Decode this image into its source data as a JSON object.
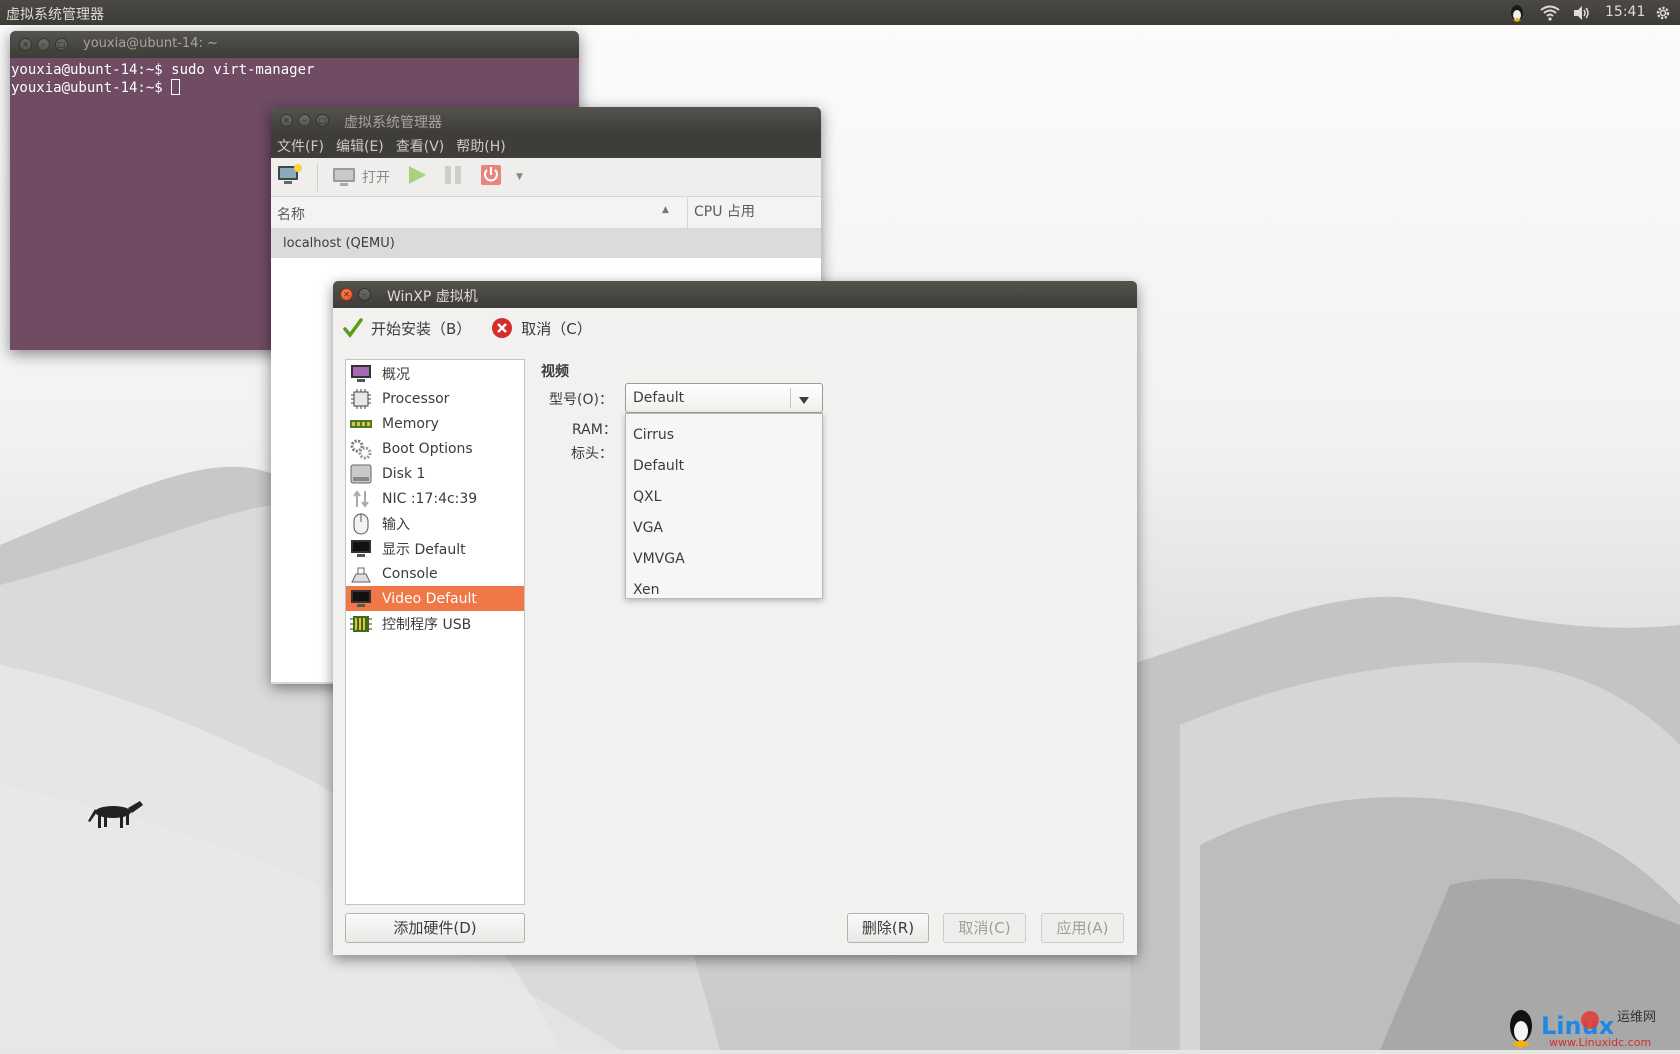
{
  "top_panel": {
    "title": "虚拟系统管理器",
    "clock": "15:41",
    "indicators": [
      "qq-penguin-icon",
      "wifi-icon",
      "volume-icon",
      "gear-icon"
    ]
  },
  "terminal": {
    "title": "youxia@ubunt-14: ~",
    "lines": [
      "youxia@ubunt-14:~$ sudo virt-manager",
      "youxia@ubunt-14:~$ "
    ]
  },
  "vmm": {
    "title": "虚拟系统管理器",
    "menus": [
      "文件(F)",
      "编辑(E)",
      "查看(V)",
      "帮助(H)"
    ],
    "toolbar": {
      "open_label": "打开"
    },
    "columns": {
      "name": "名称",
      "cpu": "CPU 占用"
    },
    "rows": [
      "localhost (QEMU)"
    ]
  },
  "dialog": {
    "title": "WinXP 虚拟机",
    "begin_install": "开始安装（B）",
    "cancel_install": "取消（C）",
    "hardware": [
      {
        "label": "概况",
        "icon": "overview-monitor-icon"
      },
      {
        "label": "Processor",
        "icon": "cpu-chip-icon"
      },
      {
        "label": "Memory",
        "icon": "memory-module-icon"
      },
      {
        "label": "Boot Options",
        "icon": "gears-icon"
      },
      {
        "label": "Disk 1",
        "icon": "disk-icon"
      },
      {
        "label": "NIC :17:4c:39",
        "icon": "network-arrows-icon"
      },
      {
        "label": "输入",
        "icon": "mouse-icon"
      },
      {
        "label": "显示 Default",
        "icon": "display-monitor-icon"
      },
      {
        "label": "Console",
        "icon": "console-icon"
      },
      {
        "label": "Video Default",
        "icon": "video-monitor-icon",
        "selected": true
      },
      {
        "label": "控制程序 USB",
        "icon": "usb-controller-icon"
      }
    ],
    "section_title": "视频",
    "model_label": "型号(O)：",
    "model_value": "Default",
    "ram_label": "RAM：",
    "heads_label": "标头：",
    "model_options": [
      "Cirrus",
      "Default",
      "QXL",
      "VGA",
      "VMVGA",
      "Xen"
    ],
    "add_hardware": "添加硬件(D)",
    "remove": "删除(R)",
    "cancel": "取消(C)",
    "apply": "应用(A)"
  },
  "watermark": {
    "line1": "运维网",
    "line2": "www.Linuxidc.com"
  },
  "colors": {
    "selection": "#f07746",
    "panel": "#3c3b37",
    "terminal_bg": "#6f4b64"
  }
}
